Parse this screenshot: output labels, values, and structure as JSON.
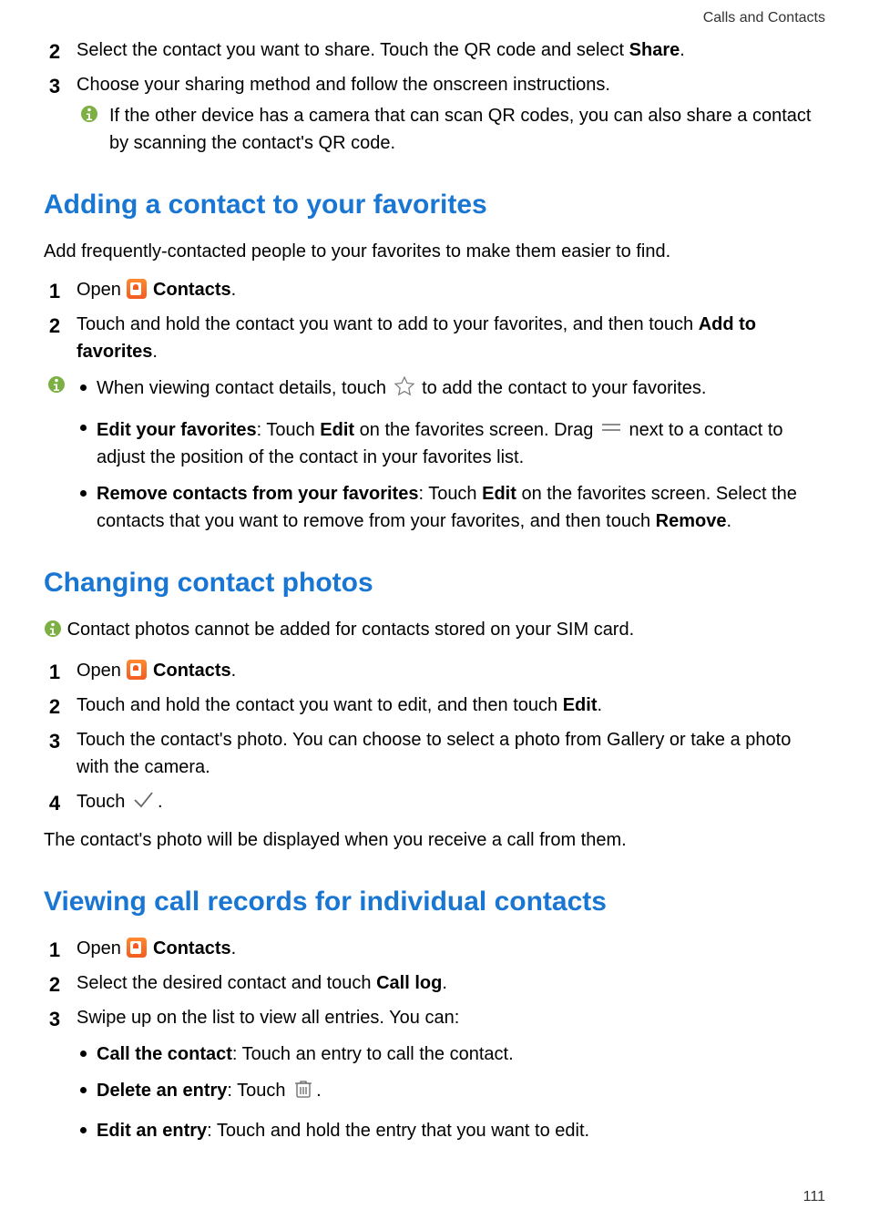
{
  "header": "Calls and Contacts",
  "pageNumber": "111",
  "intro": {
    "step2_a": "Select the contact you want to share. Touch the QR code and select ",
    "step2_b": "Share",
    "step2_c": ".",
    "step3": "Choose your sharing method and follow the onscreen instructions.",
    "note": "If the other device has a camera that can scan QR codes, you can also share a contact by scanning the contact's QR code."
  },
  "sec1": {
    "title": "Adding a contact to your favorites",
    "intro": "Add frequently-contacted people to your favorites to make them easier to find.",
    "s1_a": "Open ",
    "s1_b": "Contacts",
    "s1_c": ".",
    "s2_a": "Touch and hold the contact you want to add to your favorites, and then touch ",
    "s2_b": "Add to favorites",
    "s2_c": ".",
    "b1_a": "When viewing contact details, touch ",
    "b1_b": " to add the contact to your favorites.",
    "b2_a": "Edit your favorites",
    "b2_b": ": Touch ",
    "b2_c": "Edit",
    "b2_d": " on the favorites screen. Drag ",
    "b2_e": " next to a contact to adjust the position of the contact in your favorites list.",
    "b3_a": "Remove contacts from your favorites",
    "b3_b": ": Touch ",
    "b3_c": "Edit",
    "b3_d": " on the favorites screen. Select the contacts that you want to remove from your favorites, and then touch ",
    "b3_e": "Remove",
    "b3_f": "."
  },
  "sec2": {
    "title": "Changing contact photos",
    "note": "Contact photos cannot be added for contacts stored on your SIM card.",
    "s1_a": "Open ",
    "s1_b": "Contacts",
    "s1_c": ".",
    "s2_a": "Touch and hold the contact you want to edit, and then touch ",
    "s2_b": "Edit",
    "s2_c": ".",
    "s3": "Touch the contact's photo. You can choose to select a photo from Gallery or take a photo with the camera.",
    "s4_a": "Touch ",
    "s4_b": ".",
    "outro": "The contact's photo will be displayed when you receive a call from them."
  },
  "sec3": {
    "title": "Viewing call records for individual contacts",
    "s1_a": "Open ",
    "s1_b": "Contacts",
    "s1_c": ".",
    "s2_a": "Select the desired contact and touch ",
    "s2_b": "Call log",
    "s2_c": ".",
    "s3": "Swipe up on the list to view all entries. You can:",
    "b1_a": "Call the contact",
    "b1_b": ": Touch an entry to call the contact.",
    "b2_a": "Delete an entry",
    "b2_b": ": Touch ",
    "b2_c": ".",
    "b3_a": "Edit an entry",
    "b3_b": ": Touch and hold the entry that you want to edit."
  }
}
